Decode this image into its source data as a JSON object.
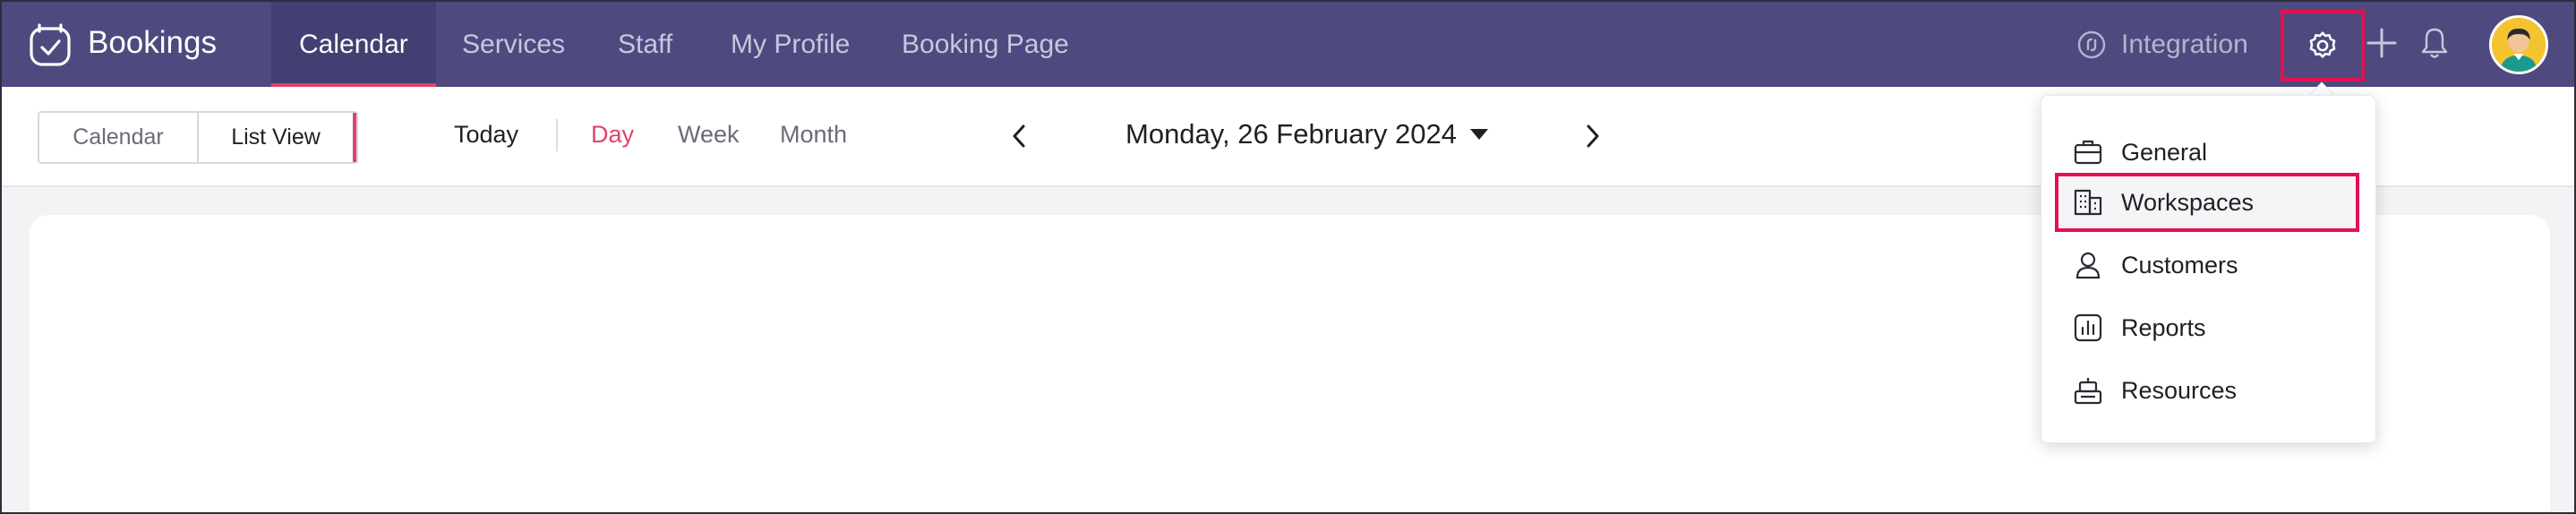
{
  "app": {
    "name": "Bookings",
    "accent_color": "#e0436a",
    "nav_color": "#4e4a7f",
    "highlight_color": "#e3114f"
  },
  "nav": {
    "tabs": [
      {
        "label": "Calendar",
        "active": true
      },
      {
        "label": "Services"
      },
      {
        "label": "Staff"
      },
      {
        "label": "My Profile"
      },
      {
        "label": "Booking Page"
      }
    ],
    "integration_label": "Integration",
    "icons": [
      "integration-icon",
      "settings-gear-icon",
      "plus-icon",
      "bell-icon",
      "avatar"
    ]
  },
  "toolbar": {
    "segment": {
      "calendar": "Calendar",
      "list_view": "List View"
    },
    "today": "Today",
    "views": {
      "day": "Day",
      "week": "Week",
      "month": "Month"
    },
    "selected_view": "Day",
    "date": "Monday, 26 February 2024"
  },
  "settings_menu": {
    "items": [
      {
        "label": "General",
        "icon": "briefcase-icon"
      },
      {
        "label": "Workspaces",
        "icon": "building-icon",
        "highlighted": true
      },
      {
        "label": "Customers",
        "icon": "user-icon"
      },
      {
        "label": "Reports",
        "icon": "reports-icon"
      },
      {
        "label": "Resources",
        "icon": "resources-icon"
      }
    ]
  }
}
